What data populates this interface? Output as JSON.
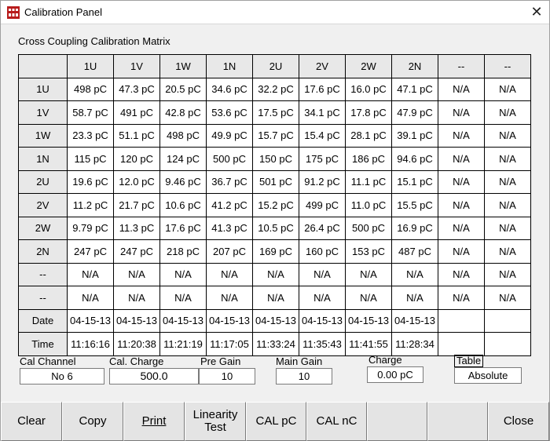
{
  "window": {
    "title": "Calibration Panel"
  },
  "matrix": {
    "title": "Cross Coupling Calibration Matrix",
    "columns": [
      "1U",
      "1V",
      "1W",
      "1N",
      "2U",
      "2V",
      "2W",
      "2N",
      "--",
      "--"
    ],
    "rows": [
      {
        "label": "1U",
        "values": [
          "498 pC",
          "47.3 pC",
          "20.5 pC",
          "34.6 pC",
          "32.2 pC",
          "17.6 pC",
          "16.0 pC",
          "47.1 pC",
          "N/A",
          "N/A"
        ]
      },
      {
        "label": "1V",
        "values": [
          "58.7 pC",
          "491 pC",
          "42.8 pC",
          "53.6 pC",
          "17.5 pC",
          "34.1 pC",
          "17.8 pC",
          "47.9 pC",
          "N/A",
          "N/A"
        ]
      },
      {
        "label": "1W",
        "values": [
          "23.3 pC",
          "51.1 pC",
          "498 pC",
          "49.9 pC",
          "15.7 pC",
          "15.4 pC",
          "28.1 pC",
          "39.1 pC",
          "N/A",
          "N/A"
        ]
      },
      {
        "label": "1N",
        "values": [
          "115 pC",
          "120 pC",
          "124 pC",
          "500 pC",
          "150 pC",
          "175 pC",
          "186 pC",
          "94.6 pC",
          "N/A",
          "N/A"
        ]
      },
      {
        "label": "2U",
        "values": [
          "19.6 pC",
          "12.0 pC",
          "9.46 pC",
          "36.7 pC",
          "501 pC",
          "91.2 pC",
          "11.1 pC",
          "15.1 pC",
          "N/A",
          "N/A"
        ]
      },
      {
        "label": "2V",
        "values": [
          "11.2 pC",
          "21.7 pC",
          "10.6 pC",
          "41.2 pC",
          "15.2 pC",
          "499 pC",
          "11.0 pC",
          "15.5 pC",
          "N/A",
          "N/A"
        ]
      },
      {
        "label": "2W",
        "values": [
          "9.79 pC",
          "11.3 pC",
          "17.6 pC",
          "41.3 pC",
          "10.5 pC",
          "26.4 pC",
          "500 pC",
          "16.9 pC",
          "N/A",
          "N/A"
        ]
      },
      {
        "label": "2N",
        "values": [
          "247 pC",
          "247 pC",
          "218 pC",
          "207 pC",
          "169 pC",
          "160 pC",
          "153 pC",
          "487 pC",
          "N/A",
          "N/A"
        ]
      },
      {
        "label": "--",
        "values": [
          "N/A",
          "N/A",
          "N/A",
          "N/A",
          "N/A",
          "N/A",
          "N/A",
          "N/A",
          "N/A",
          "N/A"
        ]
      },
      {
        "label": "--",
        "values": [
          "N/A",
          "N/A",
          "N/A",
          "N/A",
          "N/A",
          "N/A",
          "N/A",
          "N/A",
          "N/A",
          "N/A"
        ]
      },
      {
        "label": "Date",
        "values": [
          "04-15-13",
          "04-15-13",
          "04-15-13",
          "04-15-13",
          "04-15-13",
          "04-15-13",
          "04-15-13",
          "04-15-13",
          "",
          ""
        ]
      },
      {
        "label": "Time",
        "values": [
          "11:16:16",
          "11:20:38",
          "11:21:19",
          "11:17:05",
          "11:33:24",
          "11:35:43",
          "11:41:55",
          "11:28:34",
          "",
          ""
        ]
      }
    ]
  },
  "fields": {
    "cal_channel": {
      "label": "Cal Channel",
      "value": "No 6"
    },
    "cal_charge": {
      "label": "Cal. Charge",
      "value": "500.0"
    },
    "pre_gain": {
      "label": "Pre Gain",
      "value": "10"
    },
    "main_gain": {
      "label": "Main Gain",
      "value": "10"
    },
    "charge": {
      "label": "Charge",
      "value": "0.00 pC"
    },
    "table": {
      "label": "Table",
      "value": "Absolute"
    }
  },
  "buttons": {
    "clear": "Clear",
    "copy": "Copy",
    "print": "Print",
    "linearity_1": "Linearity",
    "linearity_2": "Test",
    "cal_pc": "CAL pC",
    "cal_nc": "CAL nC",
    "close": "Close"
  },
  "icons": {
    "app": "calibration-app-icon",
    "close": "close-icon"
  }
}
